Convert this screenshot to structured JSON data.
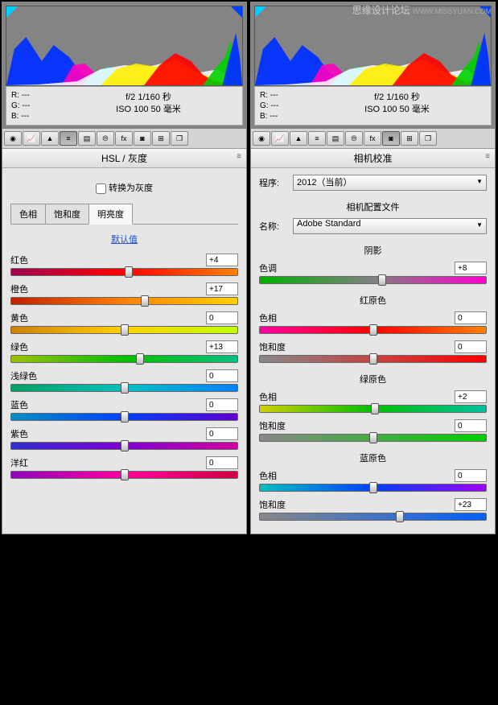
{
  "watermark": {
    "main": "思缘设计论坛",
    "sub": "WWW.MISSYUAN.COM"
  },
  "rgb": {
    "r": "R:  ---",
    "g": "G:  ---",
    "b": "B:  ---"
  },
  "exif": {
    "line1": "f/2   1/160 秒",
    "line2": "ISO 100   50 毫米"
  },
  "left": {
    "title": "HSL / 灰度",
    "grayscale_label": "转换为灰度",
    "tabs": {
      "hue": "色相",
      "sat": "饱和度",
      "lum": "明亮度"
    },
    "default_link": "默认值",
    "sliders": [
      {
        "label": "红色",
        "value": "+4",
        "pos": 52,
        "grad": "linear-gradient(90deg,#a00050,#ff0000,#ff8000)"
      },
      {
        "label": "橙色",
        "value": "+17",
        "pos": 59,
        "grad": "linear-gradient(90deg,#c02000,#ff8000,#ffd000)"
      },
      {
        "label": "黄色",
        "value": "0",
        "pos": 50,
        "grad": "linear-gradient(90deg,#d08000,#ffd000,#c0ff00)"
      },
      {
        "label": "绿色",
        "value": "+13",
        "pos": 57,
        "grad": "linear-gradient(90deg,#a0c000,#00c000,#00c080)"
      },
      {
        "label": "浅绿色",
        "value": "0",
        "pos": 50,
        "grad": "linear-gradient(90deg,#00a060,#00c0c0,#0080ff)"
      },
      {
        "label": "蓝色",
        "value": "0",
        "pos": 50,
        "grad": "linear-gradient(90deg,#0090c0,#0040ff,#6000d0)"
      },
      {
        "label": "紫色",
        "value": "0",
        "pos": 50,
        "grad": "linear-gradient(90deg,#3030d0,#8000d0,#d000a0)"
      },
      {
        "label": "洋红",
        "value": "0",
        "pos": 50,
        "grad": "linear-gradient(90deg,#9000c0,#ff00a0,#d00040)"
      }
    ]
  },
  "right": {
    "title": "相机校准",
    "process_label": "程序:",
    "process_value": "2012（当前）",
    "profile_title": "相机配置文件",
    "name_label": "名称:",
    "name_value": "Adobe Standard",
    "groups": [
      {
        "title": "阴影",
        "sliders": [
          {
            "label": "色调",
            "value": "+8",
            "pos": 54,
            "grad": "linear-gradient(90deg,#00b000,#808080,#ff00d0)"
          }
        ]
      },
      {
        "title": "红原色",
        "sliders": [
          {
            "label": "色相",
            "value": "0",
            "pos": 50,
            "grad": "linear-gradient(90deg,#ff00a0,#ff0000,#ff8000)"
          },
          {
            "label": "饱和度",
            "value": "0",
            "pos": 50,
            "grad": "linear-gradient(90deg,#888,#ff0000)"
          }
        ]
      },
      {
        "title": "绿原色",
        "sliders": [
          {
            "label": "色相",
            "value": "+2",
            "pos": 51,
            "grad": "linear-gradient(90deg,#d0d000,#00c000,#00c0a0)"
          },
          {
            "label": "饱和度",
            "value": "0",
            "pos": 50,
            "grad": "linear-gradient(90deg,#888,#00d000)"
          }
        ]
      },
      {
        "title": "蓝原色",
        "sliders": [
          {
            "label": "色相",
            "value": "0",
            "pos": 50,
            "grad": "linear-gradient(90deg,#00c0c0,#0040ff,#a000ff)"
          },
          {
            "label": "饱和度",
            "value": "+23",
            "pos": 62,
            "grad": "linear-gradient(90deg,#888,#0060ff)"
          }
        ]
      }
    ]
  },
  "chart_data": {
    "type": "histogram",
    "note": "RGB histogram, approximate shape",
    "channels": [
      "blue",
      "green",
      "red",
      "magenta",
      "cyan",
      "yellow",
      "white"
    ],
    "x_range": [
      0,
      255
    ]
  }
}
